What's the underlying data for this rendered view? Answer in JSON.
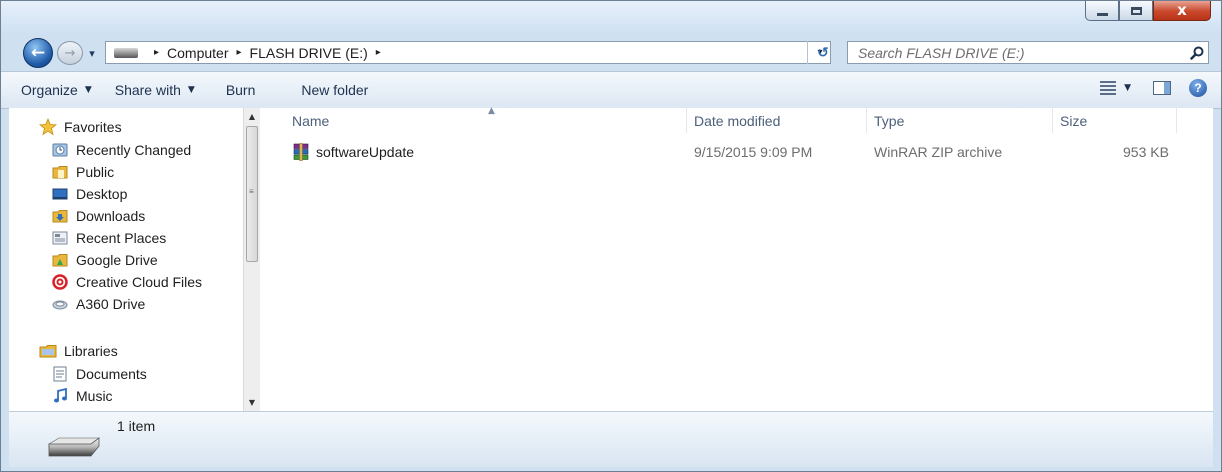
{
  "window": {
    "controls": {
      "minimize_icon": "minimize-icon",
      "maximize_icon": "maximize-icon",
      "close_icon": "close-icon",
      "close_glyph": "x"
    }
  },
  "address_bar": {
    "back_glyph": "←",
    "forward_glyph": "→",
    "recent_glyph": "▾",
    "breadcrumbs": [
      "Computer",
      "FLASH DRIVE (E:)"
    ],
    "separator": "▸",
    "dropdown_glyph": "▾",
    "refresh_glyph": "↺",
    "search_placeholder": "Search FLASH DRIVE (E:)"
  },
  "toolbar": {
    "organize": "Organize",
    "share_with": "Share with",
    "burn": "Burn",
    "new_folder": "New folder",
    "caret": "▼",
    "help_glyph": "?"
  },
  "navigation": {
    "favorites_header": "Favorites",
    "favorites": [
      "Recently Changed",
      "Public",
      "Desktop",
      "Downloads",
      "Recent Places",
      "Google Drive",
      "Creative Cloud Files",
      "A360 Drive"
    ],
    "libraries_header": "Libraries",
    "libraries": [
      "Documents",
      "Music"
    ],
    "scroll_up": "▲",
    "scroll_down": "▼",
    "scroll_grip": "≡"
  },
  "file_list": {
    "columns": {
      "name": "Name",
      "date_modified": "Date modified",
      "type": "Type",
      "size": "Size"
    },
    "sort_glyph": "▲",
    "rows": [
      {
        "name": "softwareUpdate",
        "date_modified": "9/15/2015 9:09 PM",
        "type": "WinRAR ZIP archive",
        "size": "953 KB"
      }
    ]
  },
  "details": {
    "item_count": "1 item"
  },
  "colors": {
    "accent": "#1f5aa8",
    "window_frame": "#cfe0f1",
    "close_red": "#c9482c",
    "folder_yellow": "#e9b73b"
  }
}
